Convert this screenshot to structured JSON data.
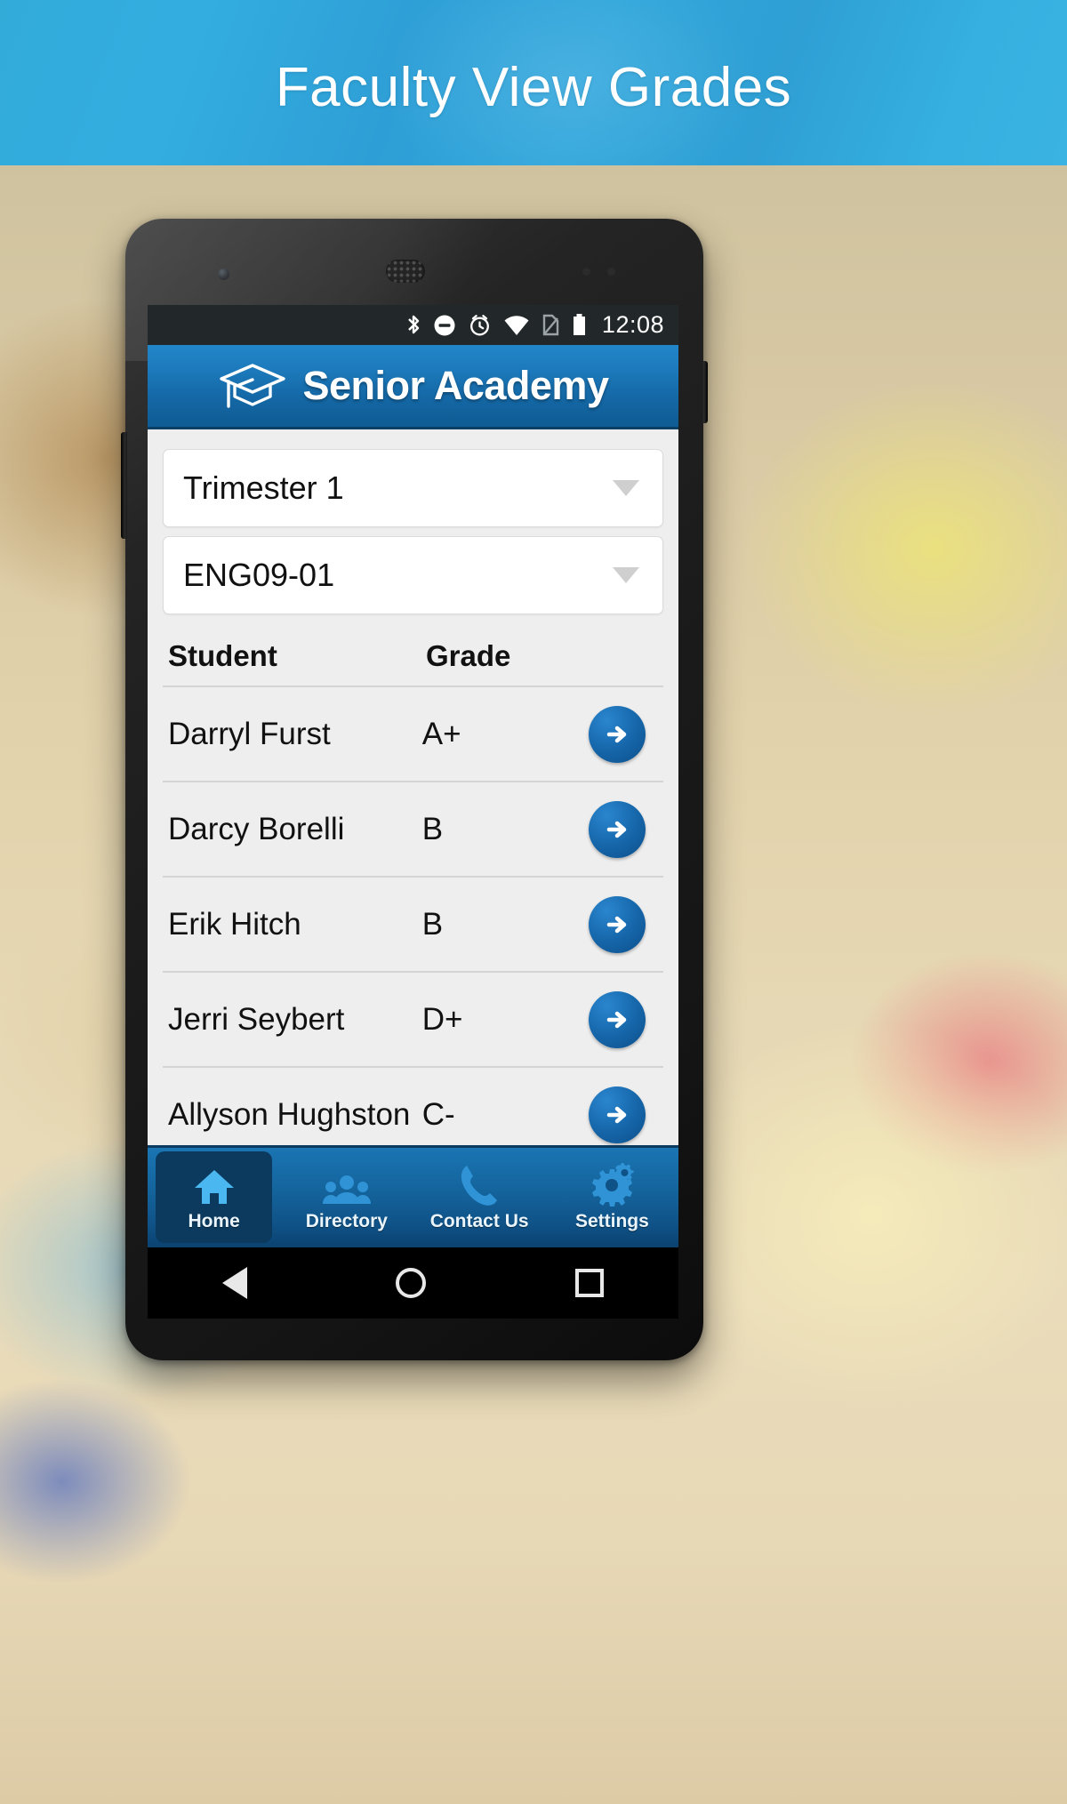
{
  "banner": {
    "title": "Faculty View Grades",
    "bg_color_left": "#32abd9",
    "bg_color_right": "#3ab3e2",
    "text_color": "#ffffff"
  },
  "phone": {
    "status_bar": {
      "time": "12:08",
      "icons": [
        "bluetooth-icon",
        "do-not-disturb-icon",
        "alarm-icon",
        "wifi-icon",
        "no-sim-icon",
        "battery-icon"
      ],
      "background": "#22282a"
    },
    "nav_bar": {
      "buttons": [
        "back-button",
        "home-button",
        "recent-apps-button"
      ]
    }
  },
  "app": {
    "header": {
      "title": "Senior Academy",
      "logo_icon": "graduation-cap-icon",
      "accent_color": "#1d7bbd"
    },
    "filters": [
      {
        "name": "trimester-select",
        "value": "Trimester 1",
        "caret_icon": "chevron-down-icon"
      },
      {
        "name": "course-select",
        "value": "ENG09-01",
        "caret_icon": "chevron-down-icon"
      }
    ],
    "grades_table": {
      "columns": [
        "Student",
        "Grade"
      ],
      "rows": [
        {
          "student": "Darryl Furst",
          "grade": "A+",
          "action_icon": "arrow-right-icon"
        },
        {
          "student": "Darcy Borelli",
          "grade": "B",
          "action_icon": "arrow-right-icon"
        },
        {
          "student": "Erik Hitch",
          "grade": "B",
          "action_icon": "arrow-right-icon"
        },
        {
          "student": "Jerri Seybert",
          "grade": "D+",
          "action_icon": "arrow-right-icon"
        },
        {
          "student": "Allyson Hughston",
          "grade": "C-",
          "action_icon": "arrow-right-icon"
        }
      ]
    },
    "tabs": [
      {
        "label": "Home",
        "icon": "home-icon",
        "active": true
      },
      {
        "label": "Directory",
        "icon": "people-icon",
        "active": false
      },
      {
        "label": "Contact Us",
        "icon": "phone-icon",
        "active": false
      },
      {
        "label": "Settings",
        "icon": "gears-icon",
        "active": false
      }
    ]
  }
}
